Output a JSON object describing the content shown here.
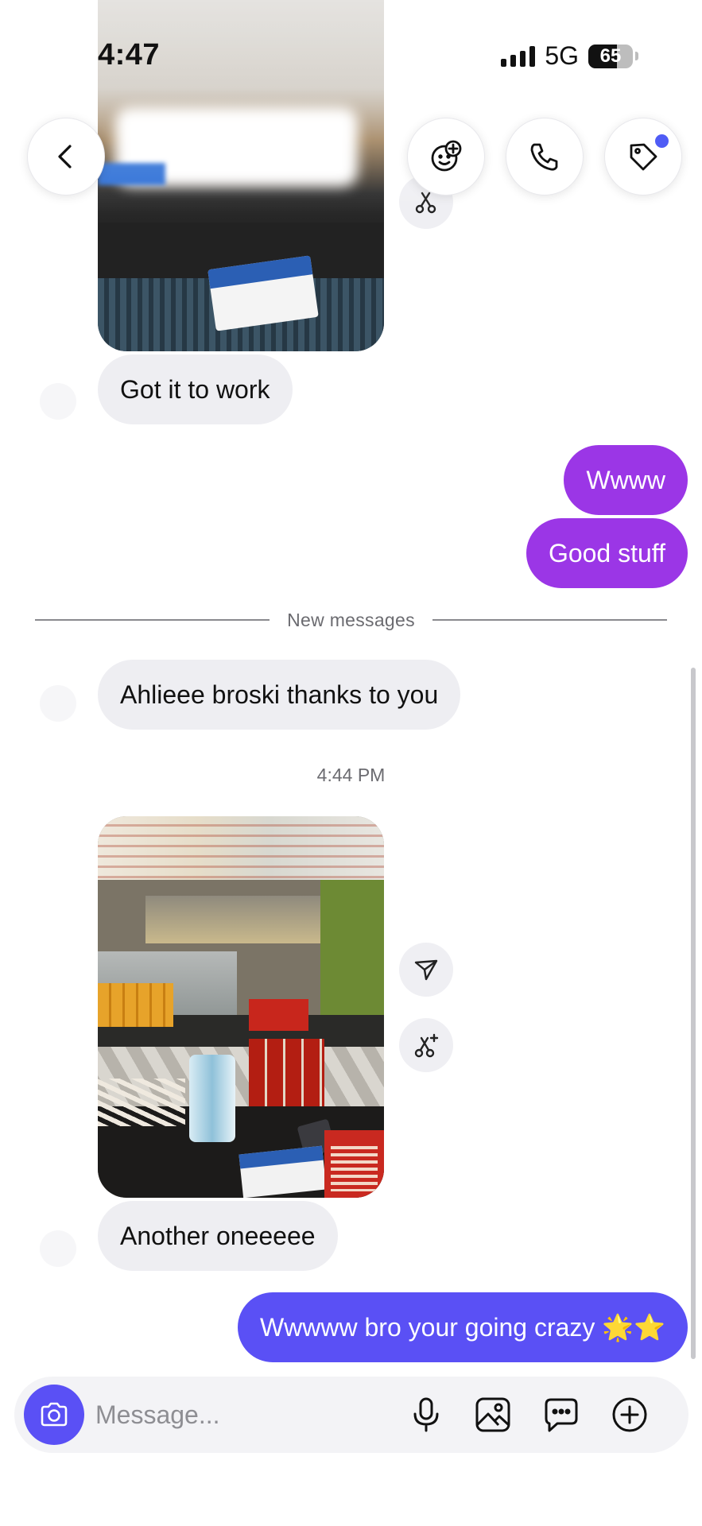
{
  "status_bar": {
    "time": "4:47",
    "network": "5G",
    "battery": "65",
    "battery_level": 0.65
  },
  "header": {
    "back_icon": "chevron-left-icon",
    "effects_icon": "sticker-add-icon",
    "call_icon": "phone-icon",
    "tag_icon": "tag-icon",
    "notification_color": "#4f5cf5"
  },
  "messages": [
    {
      "id": "m1",
      "direction": "incoming",
      "text": "Got it to work"
    },
    {
      "id": "m2",
      "direction": "outgoing",
      "text": "Wwww"
    },
    {
      "id": "m3",
      "direction": "outgoing",
      "text": "Good stuff"
    },
    {
      "id": "m4",
      "direction": "incoming",
      "text": "Ahlieee broski thanks to you"
    },
    {
      "id": "m5",
      "direction": "incoming",
      "text": "Another oneeeee"
    },
    {
      "id": "m6",
      "direction": "outgoing",
      "text": "Wwwww bro your going crazy 🌟⭐"
    }
  ],
  "divider": {
    "text": "New messages"
  },
  "timestamp": "4:44 PM",
  "composer": {
    "placeholder": "Message...",
    "camera_icon": "camera-icon",
    "mic_icon": "microphone-icon",
    "gallery_icon": "image-icon",
    "chat_icon": "chat-bubble-icon",
    "plus_icon": "plus-circle-icon"
  },
  "colors": {
    "outgoing_purple": "#9b36e6",
    "outgoing_blue": "#5a50f5",
    "incoming_bg": "#eeeef2",
    "accent": "#5a50f5"
  }
}
